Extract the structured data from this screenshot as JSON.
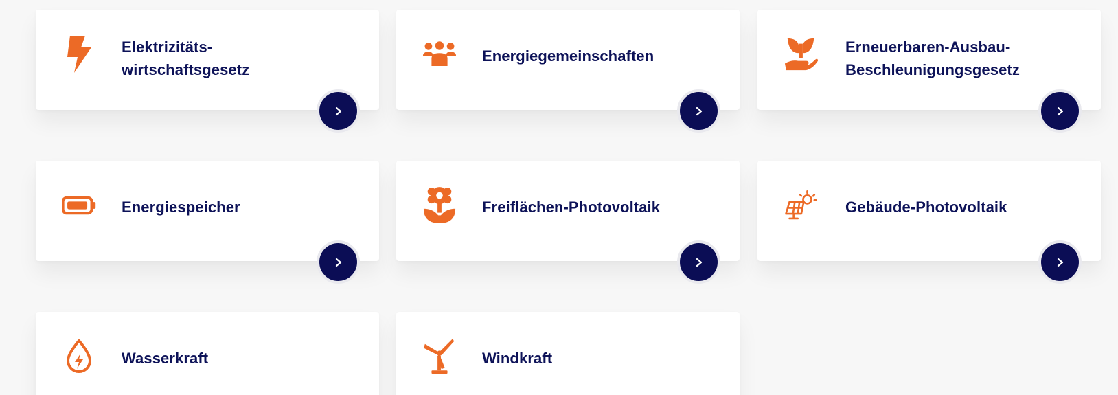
{
  "colors": {
    "accent": "#ec6a26",
    "title": "#0d1258",
    "button": "#0b0d55",
    "card": "#ffffff",
    "background": "#f7f7f7"
  },
  "cards": [
    {
      "title_line1": "Elektrizitäts-",
      "title_line2": "wirtschaftsgesetz",
      "icon": "lightning-icon"
    },
    {
      "title": "Energiegemeinschaften",
      "icon": "people-group-icon"
    },
    {
      "title_line1": "Erneuerbaren-Ausbau-",
      "title_line2": "Beschleunigungsgesetz",
      "icon": "hand-sprout-icon"
    },
    {
      "title": "Energiespeicher",
      "icon": "battery-icon"
    },
    {
      "title": "Freiflächen-Photovoltaik",
      "icon": "flower-icon"
    },
    {
      "title": "Gebäude-Photovoltaik",
      "icon": "solar-panel-sun-icon"
    },
    {
      "title": "Wasserkraft",
      "icon": "water-drop-bolt-icon"
    },
    {
      "title": "Windkraft",
      "icon": "wind-turbine-icon"
    }
  ],
  "arrow_icon": "chevron-right-icon"
}
